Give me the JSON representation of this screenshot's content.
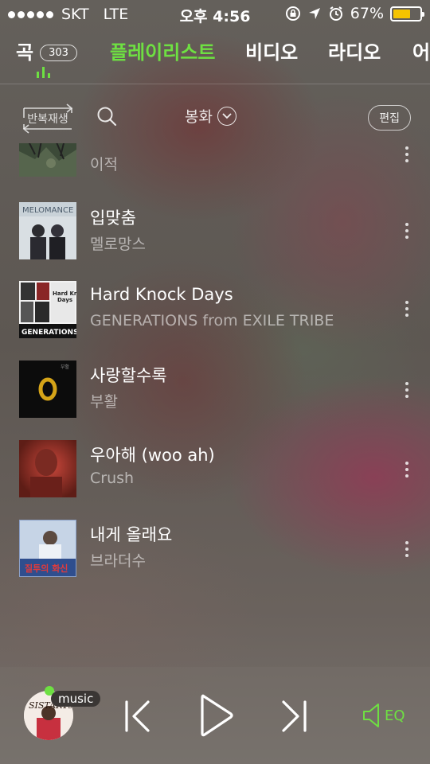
{
  "status_bar": {
    "carrier": "SKT",
    "network": "LTE",
    "time": "오후 4:56",
    "battery": "67%",
    "battery_level": 0.67
  },
  "tabs": [
    {
      "label": "곡",
      "badge": "303"
    },
    {
      "label": "플레이리스트",
      "active": true
    },
    {
      "label": "비디오"
    },
    {
      "label": "라디오"
    },
    {
      "label": "어"
    }
  ],
  "toolbar": {
    "repeat_label": "반복재생",
    "sort_label": "봉화",
    "edit_label": "편집"
  },
  "songs": [
    {
      "title": "",
      "artist": "이적"
    },
    {
      "title": "입맞춤",
      "artist": "멜로망스"
    },
    {
      "title": "Hard Knock Days",
      "artist": "GENERATIONS from EXILE TRIBE"
    },
    {
      "title": "사랑할수록",
      "artist": "부활"
    },
    {
      "title": "우아해 (woo ah)",
      "artist": "Crush"
    },
    {
      "title": "내게 올래요",
      "artist": "브라더수"
    }
  ],
  "player": {
    "badge": "music",
    "eq_label": "EQ"
  },
  "colors": {
    "accent": "#6ee042",
    "battery": "#f5c400"
  }
}
